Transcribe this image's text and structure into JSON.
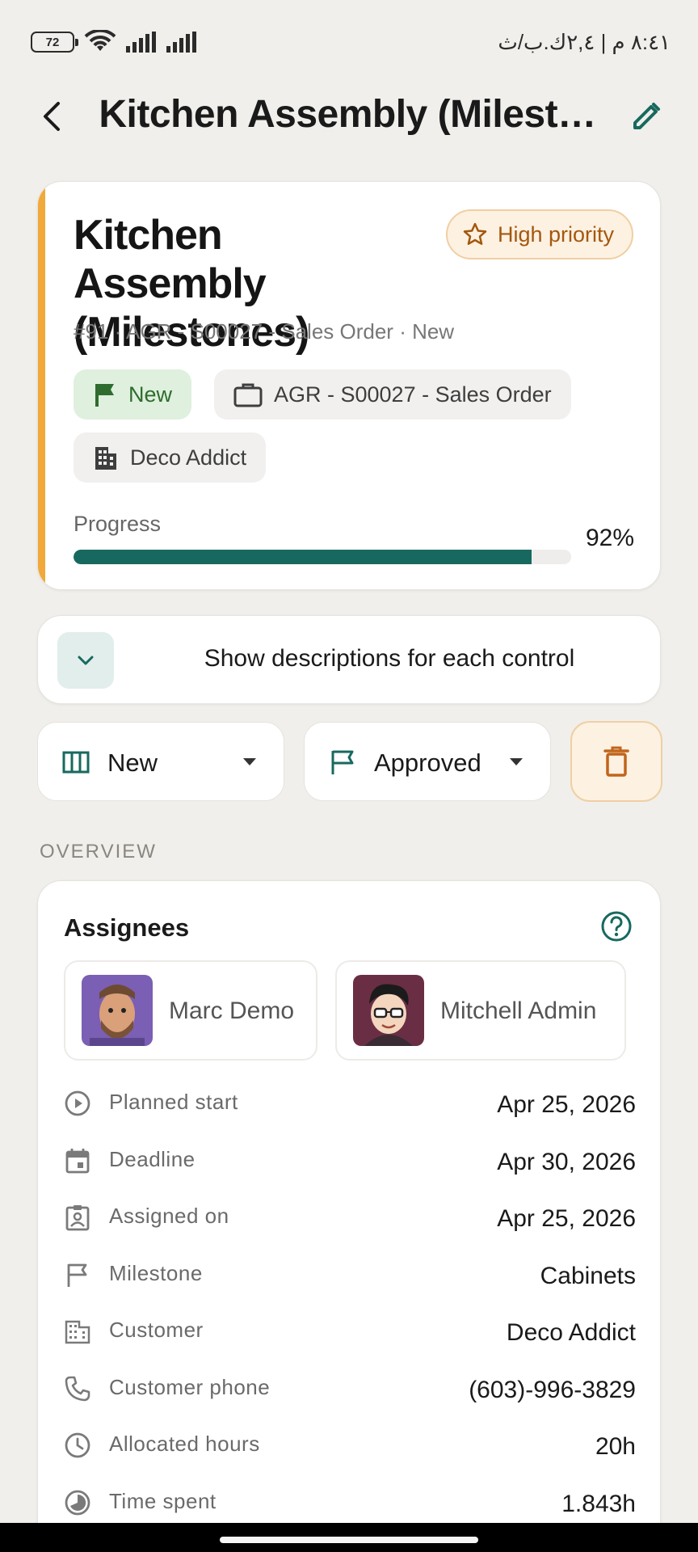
{
  "status_bar": {
    "battery": "72",
    "time": "٨:٤١ م | ٢,٤ك.ب/ث"
  },
  "app_bar": {
    "title": "Kitchen Assembly (Milest…"
  },
  "task": {
    "title": "Kitchen Assembly (Milestones)",
    "priority": "High priority",
    "subtitle": "#91 · AGR - S00027 - Sales Order · New",
    "stage_chip": "New",
    "order_chip": "AGR - S00027 - Sales Order",
    "company_chip": "Deco Addict",
    "progress_label": "Progress",
    "progress_value": "92%",
    "progress_fraction": 0.92,
    "accent_color": "#f0a93a",
    "progress_color": "#17695f"
  },
  "description_toggle": {
    "label": "Show descriptions for each control"
  },
  "controls": {
    "stage": "New",
    "state": "Approved"
  },
  "overview": {
    "section_title": "OVERVIEW",
    "assignees_title": "Assignees",
    "assignees": [
      {
        "name": "Marc Demo"
      },
      {
        "name": "Mitchell Admin"
      }
    ],
    "fields": [
      {
        "icon": "play-circle-icon",
        "label": "Planned start",
        "value": "Apr 25, 2026"
      },
      {
        "icon": "calendar-icon",
        "label": "Deadline",
        "value": "Apr 30, 2026"
      },
      {
        "icon": "assignment-icon",
        "label": "Assigned on",
        "value": "Apr 25, 2026"
      },
      {
        "icon": "flag-icon",
        "label": "Milestone",
        "value": "Cabinets"
      },
      {
        "icon": "building-icon",
        "label": "Customer",
        "value": "Deco Addict"
      },
      {
        "icon": "phone-icon",
        "label": "Customer phone",
        "value": "(603)-996-3829"
      },
      {
        "icon": "clock-icon",
        "label": "Allocated hours",
        "value": "20h"
      },
      {
        "icon": "pie-icon",
        "label": "Time spent",
        "value": "1.843h"
      }
    ]
  }
}
